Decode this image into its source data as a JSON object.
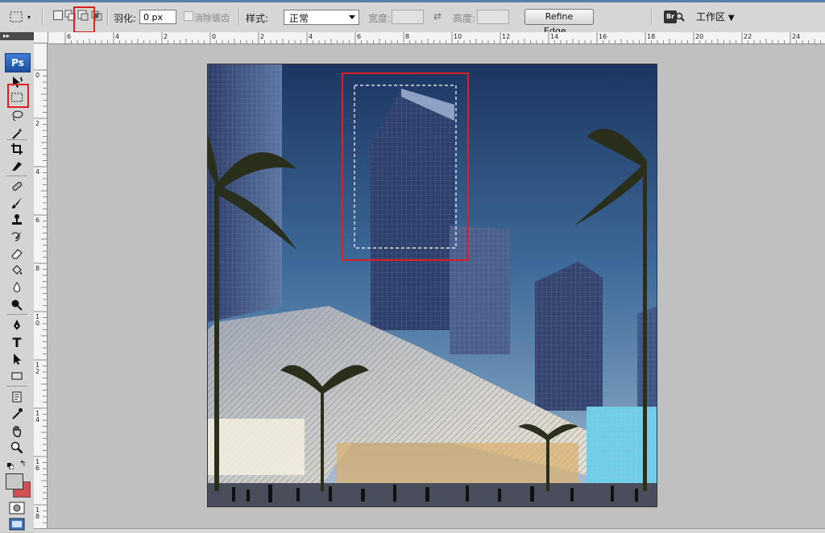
{
  "options_bar": {
    "feather_label": "羽化:",
    "feather_value": "0 px",
    "antialias_label": "消除锯齿",
    "style_label": "样式:",
    "style_value": "正常",
    "width_label": "宽度:",
    "height_label": "高度:",
    "refine_edge_label": "Refine Edge...",
    "bridge_label": "Br",
    "workspace_label": "工作区"
  },
  "toolbox": {
    "logo": "Ps",
    "tools": [
      "move-tool",
      "rect-marquee-tool",
      "lasso-tool",
      "magic-wand-tool",
      "crop-tool",
      "slice-tool",
      "healing-brush-tool",
      "brush-tool",
      "clone-stamp-tool",
      "history-brush-tool",
      "eraser-tool",
      "paint-bucket-tool",
      "blur-tool",
      "dodge-tool",
      "pen-tool",
      "type-tool",
      "path-selection-tool",
      "rectangle-shape-tool",
      "notes-tool",
      "eyedropper-tool",
      "hand-tool",
      "zoom-tool"
    ],
    "foreground_color": "#c8c8c8",
    "background_color": "#d05050"
  },
  "rulers": {
    "horizontal_labels": [
      "6",
      "4",
      "2",
      "0",
      "2",
      "4",
      "6",
      "8",
      "10",
      "12",
      "14",
      "16",
      "18",
      "20",
      "22",
      "24"
    ],
    "vertical_labels": [
      "0",
      "2",
      "4",
      "6",
      "8",
      "1\n0",
      "1\n2",
      "1\n4",
      "1\n6",
      "1\n8"
    ]
  },
  "highlight_color": "#e02020"
}
